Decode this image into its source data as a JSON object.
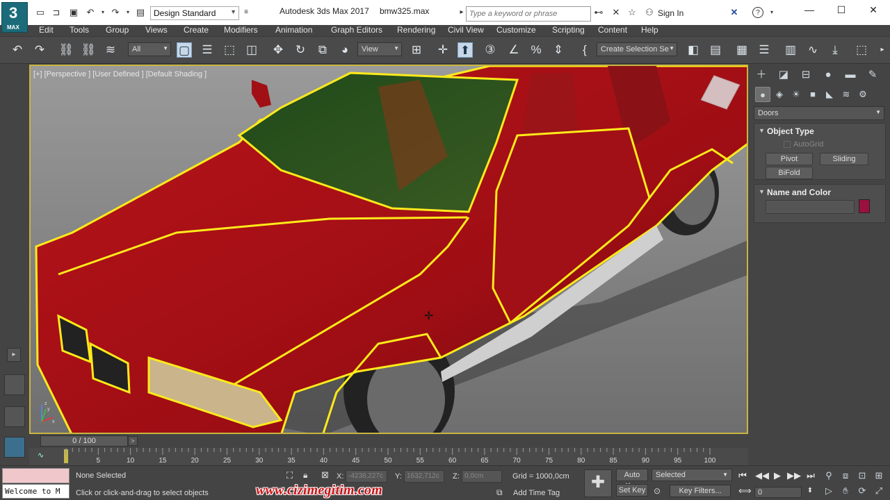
{
  "app": {
    "logo_number": "3",
    "logo_text": "MAX",
    "title": "Autodesk 3ds Max 2017",
    "file": "bmw325.max",
    "workspace": "Design Standard",
    "search_placeholder": "Type a keyword or phrase",
    "sign_in": "Sign In"
  },
  "menu": [
    "Edit",
    "Tools",
    "Group",
    "Views",
    "Create",
    "Modifiers",
    "Animation",
    "Graph Editors",
    "Rendering",
    "Civil View",
    "Customize",
    "Scripting",
    "Content",
    "Help"
  ],
  "toolbar": {
    "filter_value": "All",
    "ref_coord_value": "View",
    "selection_set_value": "Create Selection Se"
  },
  "viewport": {
    "label": "[+] [Perspective ] [User Defined ] [Default Shading ]",
    "axis_x": "x",
    "axis_y": "y",
    "axis_z": "z"
  },
  "command_panel": {
    "category": "Doors",
    "rollout_object_type": {
      "title": "Object Type",
      "autogrid": "AutoGrid",
      "buttons": [
        "Pivot",
        "Sliding",
        "BiFold"
      ]
    },
    "rollout_name_color": {
      "title": "Name and Color",
      "name_value": "",
      "color": "#9a1040"
    }
  },
  "timeline": {
    "slider_text": "0 / 100",
    "ticks": [
      "5",
      "10",
      "15",
      "20",
      "25",
      "30",
      "35",
      "40",
      "45",
      "50",
      "55",
      "60",
      "65",
      "70",
      "75",
      "80",
      "85",
      "90",
      "95",
      "100"
    ]
  },
  "status": {
    "maxscript_text": "Welcome to M",
    "selection": "None Selected",
    "prompt": "Click or click-and-drag to select objects",
    "x_label": "X:",
    "x_value": "-4238,227c",
    "y_label": "Y:",
    "y_value": "1632,712c",
    "z_label": "Z:",
    "z_value": "0,0cm",
    "grid": "Grid = 1000,0cm",
    "add_time_tag": "Add Time Tag",
    "auto_key": "Auto Key",
    "set_key": "Set Key",
    "key_set": "Selected",
    "key_filters": "Key Filters...",
    "frame": "0",
    "watermark": "www.cizimegitim.com"
  }
}
